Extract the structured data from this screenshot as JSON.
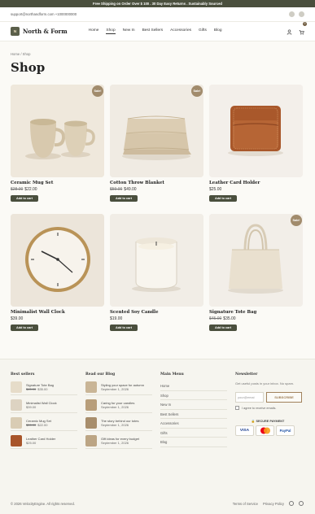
{
  "announcement": "Free Shipping on Order Over $ 100 . 30 Day Easy Returns . Sustainably Sourced",
  "utility": {
    "email": "support@northandform.com +1000000000",
    "social_icons": [
      "facebook-icon",
      "instagram-icon"
    ]
  },
  "header": {
    "logo_mark": "N",
    "brand": "North & Form",
    "nav": [
      "Home",
      "Shop",
      "New In",
      "Best Sellers",
      "Accessories",
      "Gifts",
      "Blog"
    ],
    "active_nav": "Shop",
    "cart_count": "0"
  },
  "breadcrumb": "Home / Shop",
  "page_title": "Shop",
  "products": [
    {
      "name": "Ceramic Mug Set",
      "old_price": "$28.00",
      "price": "$22.00",
      "sale": "Sale!",
      "button": "Add to cart",
      "img": "mugs"
    },
    {
      "name": "Cotton Throw Blanket",
      "old_price": "$59.00",
      "price": "$49.00",
      "sale": "Sale!",
      "button": "Add to cart",
      "img": "blanket"
    },
    {
      "name": "Leather Card Holder",
      "old_price": "",
      "price": "$25.00",
      "sale": "",
      "button": "Add to cart",
      "img": "wallet"
    },
    {
      "name": "Minimalist Wall Clock",
      "old_price": "",
      "price": "$39.00",
      "sale": "",
      "button": "Add to cart",
      "img": "clock"
    },
    {
      "name": "Scented Soy Candle",
      "old_price": "",
      "price": "$19.00",
      "sale": "",
      "button": "Add to cart",
      "img": "candle"
    },
    {
      "name": "Signature Tote Bag",
      "old_price": "$45.00",
      "price": "$35.00",
      "sale": "Sale!",
      "button": "Add to cart",
      "img": "tote"
    }
  ],
  "footer": {
    "best_sellers": {
      "title": "Best sellers",
      "items": [
        {
          "name": "Signature Tote Bag",
          "old_price": "$45.00",
          "price": "$35.00",
          "color": "#e6dcc9"
        },
        {
          "name": "Minimalist Wall Clock",
          "old_price": "",
          "price": "$39.00",
          "color": "#ddd3c2"
        },
        {
          "name": "Ceramic Mug Set",
          "old_price": "$28.00",
          "price": "$22.00",
          "color": "#d9ccb4"
        },
        {
          "name": "Leather Card Holder",
          "old_price": "",
          "price": "$25.00",
          "color": "#a8552a"
        }
      ]
    },
    "blog": {
      "title": "Read our Blog",
      "posts": [
        {
          "title": "Styling your space for autumn",
          "date": "September 1, 2026",
          "color": "#c9b596"
        },
        {
          "title": "Caring for your candles",
          "date": "September 1, 2026",
          "color": "#b89e7a"
        },
        {
          "title": "The story behind our totes",
          "date": "September 1, 2026",
          "color": "#a88e6c"
        },
        {
          "title": "Gift ideas for every budget",
          "date": "September 1, 2026",
          "color": "#bca584"
        }
      ]
    },
    "main_menu": {
      "title": "Main Menu",
      "links": [
        "Home",
        "Shop",
        "New In",
        "Best Sellers",
        "Accessories",
        "Gifts",
        "Blog"
      ]
    },
    "newsletter": {
      "title": "Newsletter",
      "text": "Get useful posts in your inbox. No spam.",
      "placeholder": "your@emai",
      "button": "SUBSCRIBE",
      "consent": "I agree to receive emails.",
      "secure": "SECURE PAYMENT",
      "payments": [
        "VISA",
        "MC",
        "PayPal"
      ]
    },
    "copyright": "© 2026 VelocityEngine. All rights reserved.",
    "links": [
      "Terms of Service",
      "Privacy Policy"
    ]
  }
}
